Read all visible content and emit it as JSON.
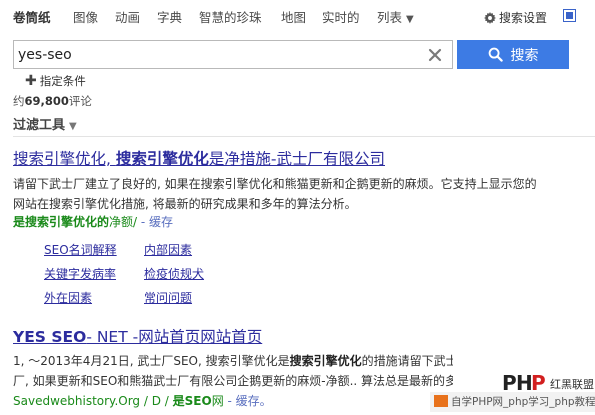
{
  "nav": {
    "items": [
      "卷筒纸",
      "图像",
      "动画",
      "字典",
      "智慧的珍珠",
      "地图",
      "实时的",
      "列表"
    ],
    "settings_label": "搜索设置"
  },
  "search": {
    "query": "yes-seo",
    "button_label": "搜索"
  },
  "filter_condition_label": "指定条件",
  "result_count": {
    "prefix": "约",
    "number": "69,800",
    "suffix": "评论"
  },
  "filter_tools_label": "过滤工具",
  "results": [
    {
      "title_a": "搜索引擎优化, ",
      "title_b": "搜索引擎优化",
      "title_c": "是净措施-武士厂有限公司",
      "snippet_line1": "请留下武士厂建立了良好的, 如果在搜索引擎优化和熊猫更新和企鹅更新的麻烦。它支持上显示您的",
      "snippet_line2": "网站在搜索引擎优化措施, 将最新的研究成果和多年的算法分析。",
      "url_bold": "是搜索引擎优化的",
      "url_rest": "净额/",
      "cache_label": "- 缓存",
      "sublinks": [
        "SEO名词解释",
        "内部因素",
        "关键字发病率",
        "检疫侦规犬",
        "外在因素",
        "常问问题"
      ]
    },
    {
      "title_a": "YES SEO",
      "title_b": "- NET -网站首页网站首页",
      "snippet_line1_a": "1, ～2013年4月21日, 武士厂SEO, 搜索引擎优化是",
      "snippet_line1_b": "搜索引擎优化",
      "snippet_line1_c": "的措施请留下武士长期建立的工",
      "snippet_line2": "厂, 如果更新和SEO和熊猫武士厂有限公司企鹅更新的麻烦-净额.. 算法总是最新的多年的研究",
      "url_a": "Savedwebhistory.Org / D / ",
      "url_bold": "是SEO",
      "url_rest": "网",
      "cache_label": "- 缓存。"
    }
  ],
  "watermark": {
    "logo_text": "红黑联盟",
    "site_text": "自学PHP网_php学习_php教程"
  },
  "colors": {
    "link": "#2c2c9e",
    "url_green": "#1a8a1a",
    "button_blue": "#3d7be4"
  }
}
